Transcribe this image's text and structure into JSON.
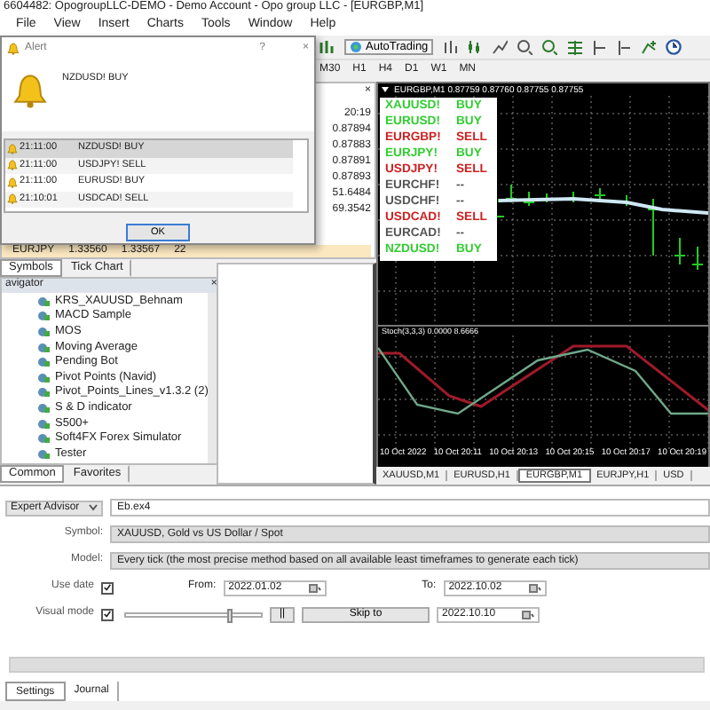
{
  "window": {
    "title": "6604482: OpogroupLLC-DEMO - Demo Account - Opo group LLC - [EURGBP,M1]"
  },
  "menu": [
    "File",
    "View",
    "Insert",
    "Charts",
    "Tools",
    "Window",
    "Help"
  ],
  "toolbar": {
    "autotrading": "AutoTrading"
  },
  "timeframes": [
    "M30",
    "H1",
    "H4",
    "D1",
    "W1",
    "MN"
  ],
  "market_watch": {
    "values": [
      "20:19",
      "0.87894",
      "0.87883",
      "0.87891",
      "0.87893",
      "51.6484",
      "69.3542"
    ],
    "last_row": {
      "symbol": "EURJPY",
      "bid": "1.33560",
      "ask": "1.33567",
      "spread": "22"
    },
    "close": "×",
    "tabs": [
      {
        "label": "Symbols",
        "selected": true
      },
      {
        "label": "Tick Chart",
        "selected": false
      }
    ]
  },
  "alert": {
    "title": "Alert",
    "help": "?",
    "close": "×",
    "message": "NZDUSD! BUY",
    "rows": [
      {
        "time": "21:11:00",
        "text": "NZDUSD! BUY",
        "selected": true
      },
      {
        "time": "21:11:00",
        "text": "USDJPY! SELL",
        "selected": false
      },
      {
        "time": "21:11:00",
        "text": "EURUSD! BUY",
        "selected": false
      },
      {
        "time": "21:10:01",
        "text": "USDCAD! SELL",
        "selected": false
      }
    ],
    "ok": "OK"
  },
  "navigator": {
    "title": "avigator",
    "close": "×",
    "items": [
      "KRS_XAUUSD_Behnam",
      "MACD Sample",
      "MOS",
      "Moving Average",
      "Pending Bot",
      "Pivot Points (Navid)",
      "Pivot_Points_Lines_v1.3.2 (2)",
      "S & D indicator",
      "S500+",
      "Soft4FX Forex Simulator",
      "Tester"
    ],
    "tabs": [
      {
        "label": "Common",
        "selected": true
      },
      {
        "label": "Favorites",
        "selected": false
      }
    ]
  },
  "chart": {
    "header": "EURGBP,M1  0.87759 0.87760 0.87755 0.87755",
    "signals": [
      {
        "symbol": "XAUUSD!",
        "signal": "BUY",
        "color": "#33cc33"
      },
      {
        "symbol": "EURUSD!",
        "signal": "BUY",
        "color": "#33cc33"
      },
      {
        "symbol": "EURGBP!",
        "signal": "SELL",
        "color": "#cc2222"
      },
      {
        "symbol": "EURJPY!",
        "signal": "BUY",
        "color": "#33cc33"
      },
      {
        "symbol": "USDJPY!",
        "signal": "SELL",
        "color": "#cc2222"
      },
      {
        "symbol": "EURCHF!",
        "signal": "--",
        "color": "#555555"
      },
      {
        "symbol": "USDCHF!",
        "signal": "--",
        "color": "#555555"
      },
      {
        "symbol": "USDCAD!",
        "signal": "SELL",
        "color": "#cc2222"
      },
      {
        "symbol": "EURCAD!",
        "signal": "--",
        "color": "#555555"
      },
      {
        "symbol": "NZDUSD!",
        "signal": "BUY",
        "color": "#33cc33"
      }
    ],
    "indicator_header": "Stoch(3,3,3) 0.0000 8.6666",
    "time_labels": [
      "10 Oct 2022",
      "10 Oct 20:11",
      "10 Oct 20:13",
      "10 Oct 20:15",
      "10 Oct 20:17",
      "10 Oct 20:19"
    ],
    "tabs": [
      {
        "label": "XAUUSD,M1",
        "selected": false
      },
      {
        "label": "EURUSD,H1",
        "selected": false
      },
      {
        "label": "EURGBP,M1",
        "selected": true
      },
      {
        "label": "EURJPY,H1",
        "selected": false
      },
      {
        "label": "USD",
        "selected": false
      }
    ]
  },
  "tester": {
    "mode": "Expert Advisor",
    "expert": "Eb.ex4",
    "symbol_label": "Symbol:",
    "symbol": "XAUUSD, Gold vs US Dollar / Spot",
    "model_label": "Model:",
    "model": "Every tick (the most precise method based on all available least timeframes to generate each tick)",
    "use_date_label": "Use date",
    "use_date": true,
    "from_label": "From:",
    "from": "2022.01.02",
    "to_label": "To:",
    "to": "2022.10.02",
    "visual_label": "Visual mode",
    "visual": true,
    "speed": {
      "level": 0.75
    },
    "pause": "||",
    "skip": "Skip to",
    "skip_date": "2022.10.10",
    "progress": {
      "level": 0
    },
    "tabs": [
      {
        "label": "Settings",
        "selected": true
      },
      {
        "label": "Journal",
        "selected": false
      }
    ]
  }
}
